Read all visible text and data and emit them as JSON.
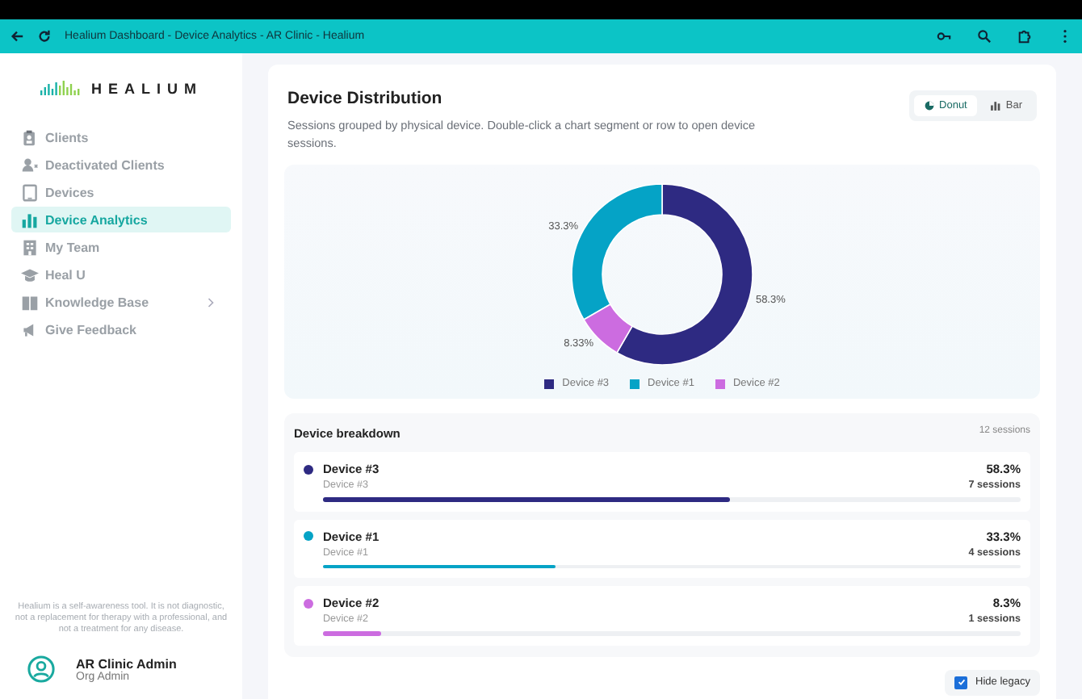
{
  "browser": {
    "title": "Healium Dashboard - Device Analytics - AR Clinic - Healium"
  },
  "sidebar": {
    "logo": "HEALIUM",
    "items": [
      {
        "label": "Clients",
        "selected": false,
        "has_submenu": false
      },
      {
        "label": "Deactivated Clients",
        "selected": false,
        "has_submenu": false
      },
      {
        "label": "Devices",
        "selected": false,
        "has_submenu": false
      },
      {
        "label": "Device Analytics",
        "selected": true,
        "has_submenu": false
      },
      {
        "label": "My Team",
        "selected": false,
        "has_submenu": false
      },
      {
        "label": "Heal U",
        "selected": false,
        "has_submenu": false
      },
      {
        "label": "Knowledge Base",
        "selected": false,
        "has_submenu": true
      },
      {
        "label": "Give Feedback",
        "selected": false,
        "has_submenu": false
      }
    ],
    "disclaimer": "Healium is a self-awareness tool. It is not diagnostic, not a replacement for therapy with a professional, and not a treatment for any disease.",
    "user": {
      "name": "AR Clinic Admin",
      "role": "Org Admin"
    }
  },
  "card": {
    "title": "Device Distribution",
    "subtitle": "Sessions grouped by physical device. Double-click a chart segment or row to open device sessions.",
    "view_toggle": [
      {
        "label": "Donut",
        "selected": true
      },
      {
        "label": "Bar",
        "selected": false
      }
    ],
    "chart_data": {
      "type": "donut",
      "categories": [
        "Device #3",
        "Device #1",
        "Device #2"
      ],
      "values": [
        58.33,
        33.33,
        8.33
      ],
      "colors": [
        "#2e2a82",
        "#05a3c6",
        "#cc6ce0"
      ],
      "value_labels": [
        "58.3%",
        "33.3%",
        "8.33%"
      ]
    },
    "breakdown": {
      "title": "Device breakdown",
      "total": "12 sessions",
      "rows": [
        {
          "name": "Device #3",
          "detail": "Device #3",
          "percent": "58.3%",
          "sessions": "7 sessions",
          "color": "#2e2a82",
          "level": 0.583
        },
        {
          "name": "Device #1",
          "detail": "Device #1",
          "percent": "33.3%",
          "sessions": "4 sessions",
          "color": "#05a3c6",
          "level": 0.333
        },
        {
          "name": "Device #2",
          "detail": "Device #2",
          "percent": "8.3%",
          "sessions": "1 sessions",
          "color": "#cc6ce0",
          "level": 0.083
        }
      ]
    },
    "hide_legacy": {
      "label": "Hide legacy",
      "checked": true
    }
  }
}
